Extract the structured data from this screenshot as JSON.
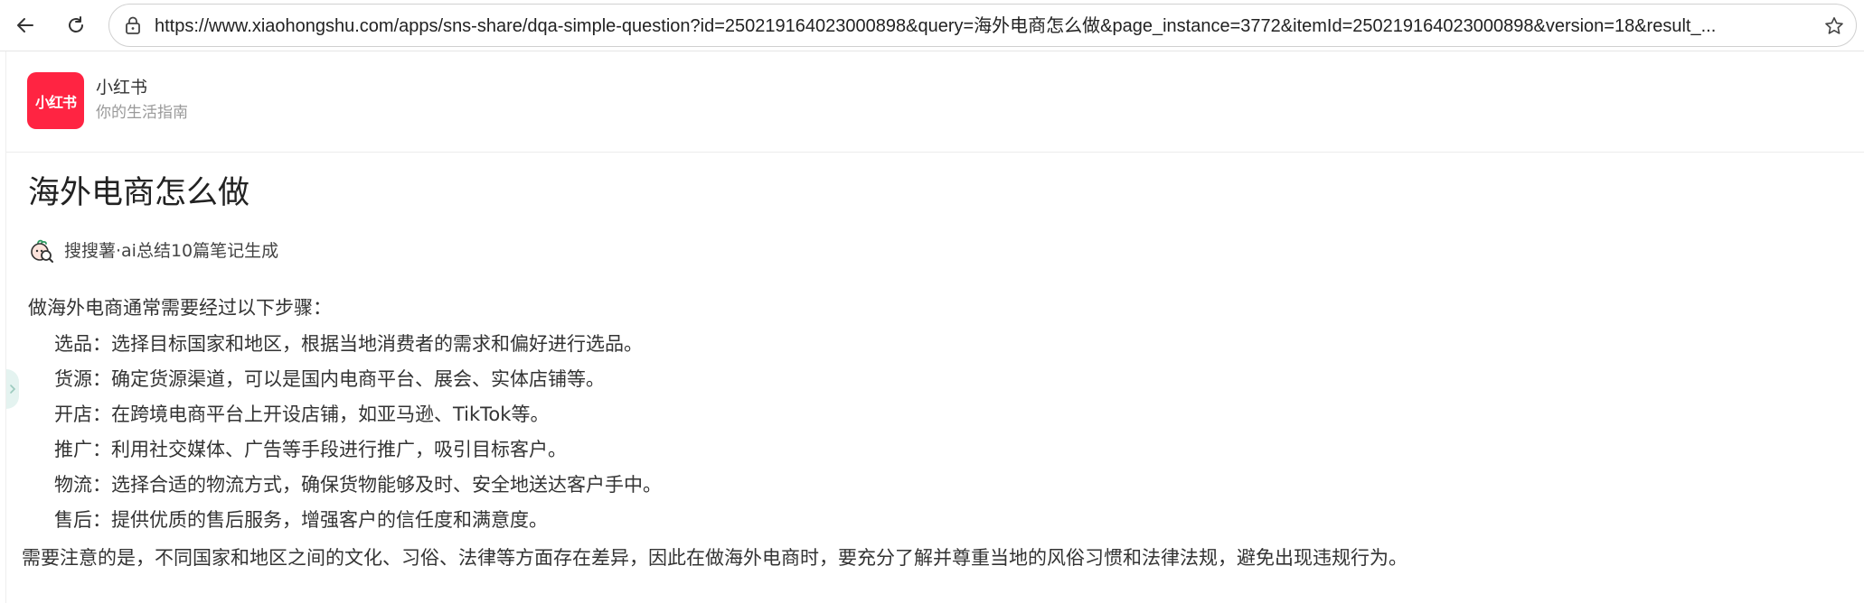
{
  "browser": {
    "url": "https://www.xiaohongshu.com/apps/sns-share/dqa-simple-question?id=25021916402300089​8&query=海外电商怎么做&page_instance=3772&itemId=250219164023000898&version=18&result_..."
  },
  "site": {
    "logo_text": "小红书",
    "name": "小红书",
    "slogan": "你的生活指南"
  },
  "question": {
    "title": "海外电商怎么做",
    "source": "搜搜薯·ai总结10篇笔记生成"
  },
  "answer": {
    "intro": "做海外电商通常需要经过以下步骤：",
    "steps": [
      "选品：选择目标国家和地区，根据当地消费者的需求和偏好进行选品。",
      "货源：确定货源渠道，可以是国内电商平台、展会、实体店铺等。",
      "开店：在跨境电商平台上开设店铺，如亚马逊、TikTok等。",
      "推广：利用社交媒体、广告等手段进行推广，吸引目标客户。",
      "物流：选择合适的物流方式，确保货物能够及时、安全地送达客户手中。",
      "售后：提供优质的售后服务，增强客户的信任度和满意度。"
    ],
    "note": "需要注意的是，不同国家和地区之间的文化、习俗、法律等方面存在差异，因此在做海外电商时，要充分了解并尊重当地的风俗习惯和法律法规，避免出现违规行为。"
  },
  "icons": {
    "back": "arrow-left-icon",
    "reload": "reload-icon",
    "lock": "lock-icon",
    "star": "star-icon",
    "source": "ai-assistant-icon"
  },
  "colors": {
    "brand": "#ff2442",
    "text": "#333333",
    "muted": "#999999"
  }
}
